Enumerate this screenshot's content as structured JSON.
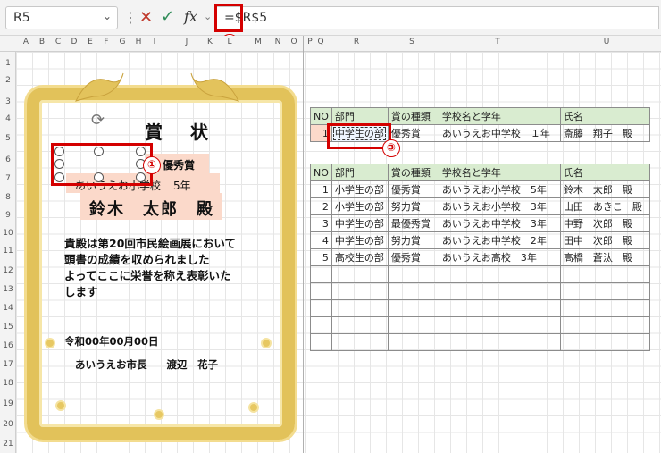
{
  "formula_bar": {
    "name_box": "R5",
    "formula": "=$R$5",
    "cancel_icon": "x-icon",
    "enter_icon": "check-icon",
    "fx_label": "fx"
  },
  "columns": [
    "A",
    "B",
    "C",
    "D",
    "E",
    "F",
    "G",
    "H",
    "I",
    "J",
    "K",
    "L",
    "M",
    "N",
    "O",
    "P",
    "Q",
    "R",
    "S",
    "T",
    "U"
  ],
  "rows": [
    "1",
    "2",
    "3",
    "4",
    "5",
    "6",
    "7",
    "8",
    "9",
    "10",
    "11",
    "12",
    "13",
    "14",
    "15",
    "16",
    "17",
    "18",
    "19",
    "20",
    "21"
  ],
  "markers": [
    "①",
    "②",
    "③"
  ],
  "certificate": {
    "title": "賞 状",
    "award": "優秀賞",
    "school": "あいうえお小学校",
    "grade": "5年",
    "name": "鈴木　太郎　殿",
    "body_lines": [
      "貴殿は第20回市民絵画展において",
      "頭書の成績を収められました",
      "よってここに栄誉を称え表彰いた",
      "します"
    ],
    "date": "令和00年00月00日",
    "signer_title": "あいうえお市長",
    "signer_name": "渡辺　花子"
  },
  "top_table": {
    "headers": [
      "NO",
      "部門",
      "賞の種類",
      "学校名と学年",
      "氏名"
    ],
    "row": [
      "1",
      "中学生の部",
      "優秀賞",
      "あいうえお中学校　１年",
      "斎藤　翔子　殿"
    ]
  },
  "main_table": {
    "headers": [
      "NO",
      "部門",
      "賞の種類",
      "学校名と学年",
      "氏名"
    ],
    "rows": [
      [
        "1",
        "小学生の部",
        "優秀賞",
        "あいうえお小学校　5年",
        "鈴木　太郎　殿"
      ],
      [
        "2",
        "小学生の部",
        "努力賞",
        "あいうえお小学校　3年",
        "山田　あきこ　殿"
      ],
      [
        "3",
        "中学生の部",
        "最優秀賞",
        "あいうえお中学校　3年",
        "中野　次郎　殿"
      ],
      [
        "4",
        "中学生の部",
        "努力賞",
        "あいうえお中学校　2年",
        "田中　次郎　殿"
      ],
      [
        "5",
        "高校生の部",
        "優秀賞",
        "あいうえお高校　3年",
        "高橋　蒼汰　殿"
      ]
    ],
    "empty_rows": 5
  }
}
